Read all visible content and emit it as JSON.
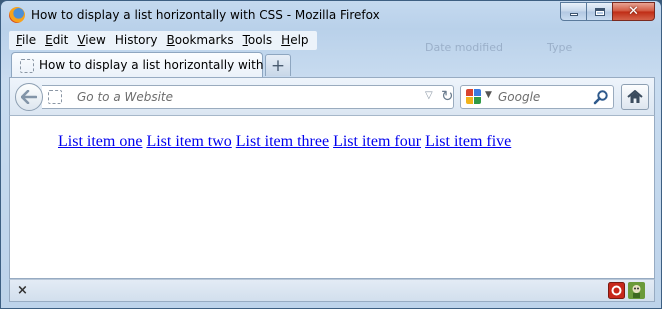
{
  "window": {
    "title": "How to display a list horizontally with CSS - Mozilla Firefox"
  },
  "background_ghost": {
    "col_date": "Date modified",
    "col_type": "Type"
  },
  "menubar": {
    "items": [
      {
        "label": "File",
        "access": "F",
        "rest": "ile"
      },
      {
        "label": "Edit",
        "access": "E",
        "rest": "dit"
      },
      {
        "label": "View",
        "access": "V",
        "rest": "iew"
      },
      {
        "label": "History",
        "access": "H",
        "rest": "istory",
        "pre": ""
      },
      {
        "label": "Bookmarks",
        "access": "B",
        "rest": "ookmarks"
      },
      {
        "label": "Tools",
        "access": "T",
        "rest": "ools"
      },
      {
        "label": "Help",
        "access": "H",
        "rest": "elp"
      }
    ]
  },
  "tabs": [
    {
      "label": "How to display a list horizontally with CSS",
      "active": true
    }
  ],
  "newtab_symbol": "+",
  "navbar": {
    "url_placeholder": "Go to a Website",
    "search_placeholder": "Google"
  },
  "page": {
    "list_items": [
      "List item one",
      "List item two",
      "List item three",
      "List item four",
      "List item five"
    ],
    "link_color": "#0000ee"
  },
  "addon_bar": {
    "close_symbol": "×"
  },
  "icons": {
    "app": "firefox-logo-icon",
    "back": "back-arrow-icon",
    "home": "home-icon",
    "search": "magnifier-icon",
    "reload": "reload-icon",
    "search_engine": "google-icon"
  }
}
